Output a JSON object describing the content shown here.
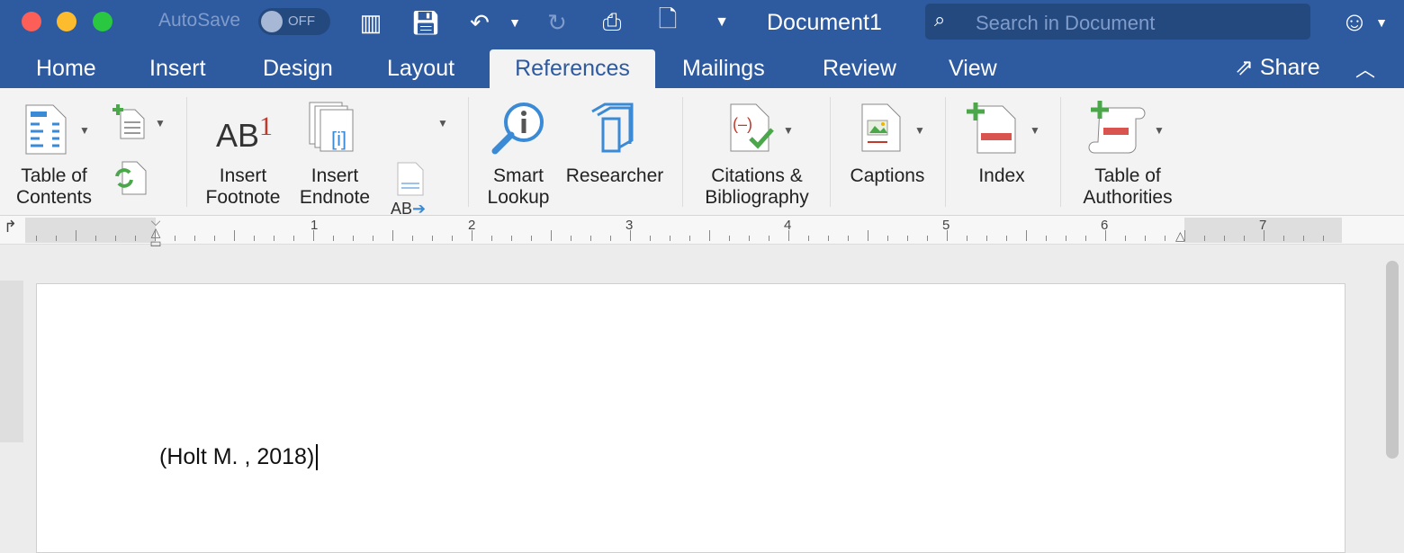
{
  "window": {
    "title": "Document1",
    "autosave_label": "AutoSave",
    "autosave_state": "OFF",
    "search_placeholder": "Search in Document",
    "share_label": "Share"
  },
  "tabs": [
    {
      "label": "Home"
    },
    {
      "label": "Insert"
    },
    {
      "label": "Design"
    },
    {
      "label": "Layout"
    },
    {
      "label": "References",
      "active": true
    },
    {
      "label": "Mailings"
    },
    {
      "label": "Review"
    },
    {
      "label": "View"
    }
  ],
  "ribbon": {
    "toc": "Table of\nContents",
    "footnote": "Insert\nFootnote",
    "endnote": "Insert\nEndnote",
    "smart_lookup": "Smart\nLookup",
    "researcher": "Researcher",
    "citations": "Citations &\nBibliography",
    "captions": "Captions",
    "index": "Index",
    "authorities": "Table of\nAuthorities",
    "footnote_glyph": "AB",
    "footnote_sup": "1"
  },
  "ruler": {
    "numbers": [
      "1",
      "2",
      "3",
      "4",
      "5",
      "6",
      "7"
    ]
  },
  "document": {
    "text": "(Holt M. , 2018)"
  },
  "colors": {
    "titlebar": "#2e5aa0",
    "ribbon": "#f3f3f3",
    "accent_red": "#c0392b",
    "icon_blue": "#3a8ad6",
    "icon_green": "#4aa84a"
  }
}
